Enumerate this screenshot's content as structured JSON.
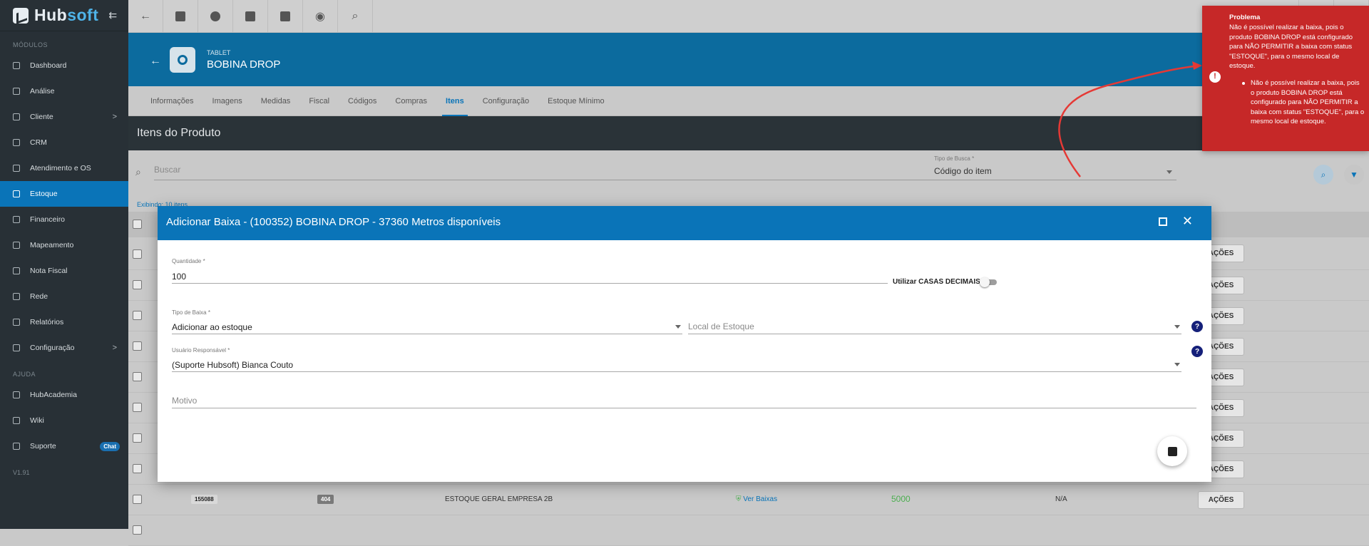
{
  "app": {
    "brand_a": "Hub",
    "brand_b": "soft"
  },
  "sidebar": {
    "section_modules": "MÓDULOS",
    "items": [
      {
        "label": "Dashboard"
      },
      {
        "label": "Análise"
      },
      {
        "label": "Cliente",
        "chevron": ">"
      },
      {
        "label": "CRM"
      },
      {
        "label": "Atendimento e OS"
      },
      {
        "label": "Estoque"
      },
      {
        "label": "Financeiro"
      },
      {
        "label": "Mapeamento"
      },
      {
        "label": "Nota Fiscal"
      },
      {
        "label": "Rede"
      },
      {
        "label": "Relatórios"
      },
      {
        "label": "Configuração",
        "chevron": ">"
      }
    ],
    "section_help": "AJUDA",
    "help_items": [
      {
        "label": "HubAcademia"
      },
      {
        "label": "Wiki"
      },
      {
        "label": "Suporte",
        "badge": "Chat"
      }
    ],
    "version": "V1.91"
  },
  "header": {
    "subtitle": "TABLET",
    "title": "BOBINA DROP"
  },
  "tabs": [
    "Informações",
    "Imagens",
    "Medidas",
    "Fiscal",
    "Códigos",
    "Compras",
    "Itens",
    "Configuração",
    "Estoque Mínimo"
  ],
  "section_title": "Itens do Produto",
  "search": {
    "placeholder": "Buscar",
    "tipo_label": "Tipo de Busca *",
    "tipo_value": "Código do item"
  },
  "exibindo": "Exibindo: 10 itens",
  "table": {
    "action_label": "AÇÕES",
    "visible_row": {
      "code": "155088",
      "badge": "404",
      "location": "ESTOQUE GERAL EMPRESA 2B",
      "link": "Ver Baixas",
      "qty": "5000",
      "extra": "N/A"
    }
  },
  "modal": {
    "title": "Adicionar Baixa - (100352) BOBINA DROP - 37360 Metros disponíveis",
    "quantidade_label": "Quantidade *",
    "quantidade_value": "100",
    "casas_decimais": "Utilizar CASAS DECIMAIS ?",
    "tipo_baixa_label": "Tipo de Baixa *",
    "tipo_baixa_value": "Adicionar ao estoque",
    "local_placeholder": "Local de Estoque",
    "usuario_label": "Usuário Responsável *",
    "usuario_value": "(Suporte Hubsoft) Bianca Couto",
    "motivo_placeholder": "Motivo",
    "help_glyph": "?"
  },
  "toast": {
    "title": "Problema",
    "message": "Não é possível realizar a baixa, pois o produto BOBINA DROP está configurado para NÃO PERMITIR a baixa com status \"ESTOQUE\", para o mesmo local de estoque.",
    "bullet": "Não é possível realizar a baixa, pois o produto BOBINA DROP está configurado para NÃO PERMITIR a baixa com status \"ESTOQUE\", para o mesmo local de estoque."
  },
  "colors": {
    "primary": "#0a74b8",
    "toast": "#c62828",
    "sidebar": "#283036",
    "arrow": "#e53935",
    "qty_green": "#4caf50"
  }
}
